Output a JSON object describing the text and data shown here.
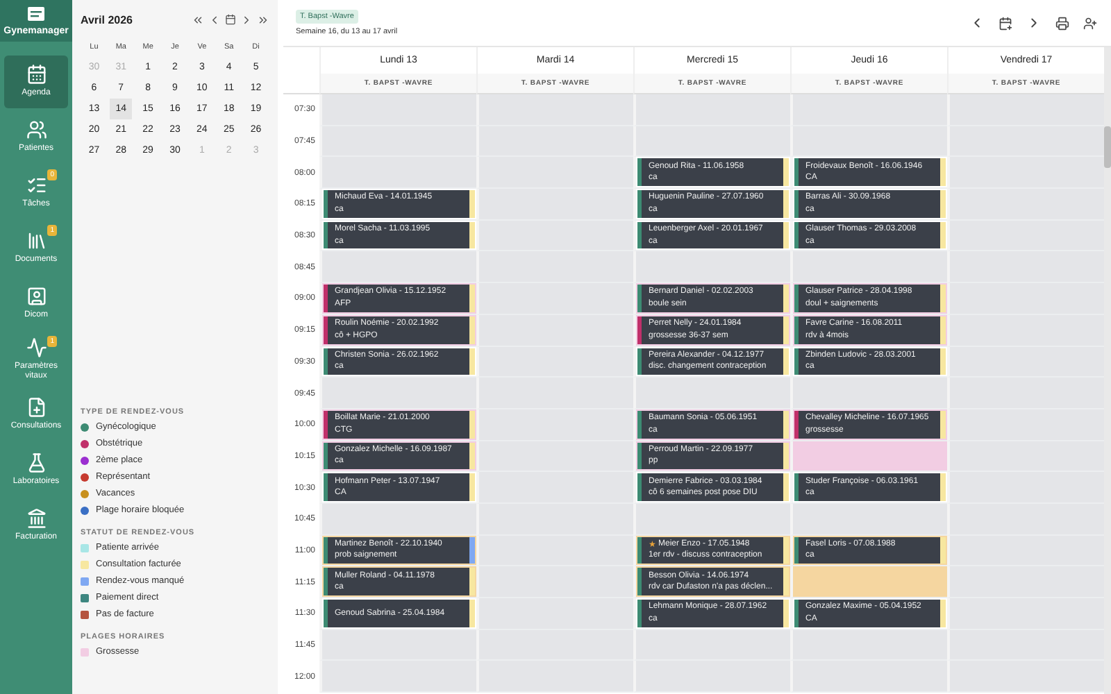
{
  "app": {
    "name": "Gynemanager"
  },
  "nav": [
    {
      "label": "Agenda",
      "selected": true
    },
    {
      "label": "Patientes",
      "selected": false
    },
    {
      "label": "Tâches",
      "selected": false,
      "badge": "0"
    },
    {
      "label": "Documents",
      "selected": false,
      "badge": "1"
    },
    {
      "label": "Dicom",
      "selected": false
    },
    {
      "label": "Paramètres vitaux",
      "selected": false,
      "badge": "1"
    },
    {
      "label": "Consultations",
      "selected": false
    },
    {
      "label": "Laboratoires",
      "selected": false
    },
    {
      "label": "Facturation",
      "selected": false
    }
  ],
  "mini_calendar": {
    "title": "Avril 2026",
    "weekdays": [
      "Lu",
      "Ma",
      "Me",
      "Je",
      "Ve",
      "Sa",
      "Di"
    ],
    "weeks": [
      [
        {
          "label": "30",
          "muted": true,
          "selected": false
        },
        {
          "label": "31",
          "muted": true,
          "selected": false
        },
        {
          "label": "1",
          "muted": false,
          "selected": false
        },
        {
          "label": "2",
          "muted": false,
          "selected": false
        },
        {
          "label": "3",
          "muted": false,
          "selected": false
        },
        {
          "label": "4",
          "muted": false,
          "selected": false
        },
        {
          "label": "5",
          "muted": false,
          "selected": false
        }
      ],
      [
        {
          "label": "6",
          "muted": false,
          "selected": false
        },
        {
          "label": "7",
          "muted": false,
          "selected": false
        },
        {
          "label": "8",
          "muted": false,
          "selected": false
        },
        {
          "label": "9",
          "muted": false,
          "selected": false
        },
        {
          "label": "10",
          "muted": false,
          "selected": false
        },
        {
          "label": "11",
          "muted": false,
          "selected": false
        },
        {
          "label": "12",
          "muted": false,
          "selected": false
        }
      ],
      [
        {
          "label": "13",
          "muted": false,
          "selected": false
        },
        {
          "label": "14",
          "muted": false,
          "selected": true
        },
        {
          "label": "15",
          "muted": false,
          "selected": false
        },
        {
          "label": "16",
          "muted": false,
          "selected": false
        },
        {
          "label": "17",
          "muted": false,
          "selected": false
        },
        {
          "label": "18",
          "muted": false,
          "selected": false
        },
        {
          "label": "19",
          "muted": false,
          "selected": false
        }
      ],
      [
        {
          "label": "20",
          "muted": false,
          "selected": false
        },
        {
          "label": "21",
          "muted": false,
          "selected": false
        },
        {
          "label": "22",
          "muted": false,
          "selected": false
        },
        {
          "label": "23",
          "muted": false,
          "selected": false
        },
        {
          "label": "24",
          "muted": false,
          "selected": false
        },
        {
          "label": "25",
          "muted": false,
          "selected": false
        },
        {
          "label": "26",
          "muted": false,
          "selected": false
        }
      ],
      [
        {
          "label": "27",
          "muted": false,
          "selected": false
        },
        {
          "label": "28",
          "muted": false,
          "selected": false
        },
        {
          "label": "29",
          "muted": false,
          "selected": false
        },
        {
          "label": "30",
          "muted": false,
          "selected": false
        },
        {
          "label": "1",
          "muted": true,
          "selected": false
        },
        {
          "label": "2",
          "muted": true,
          "selected": false
        },
        {
          "label": "3",
          "muted": true,
          "selected": false
        }
      ]
    ]
  },
  "legend": [
    {
      "title": "TYPE DE RENDEZ-VOUS",
      "kind": "dot",
      "items": [
        {
          "label": "Gynécologique",
          "color": "#3d8b73"
        },
        {
          "label": "Obstétrique",
          "color": "#c0306a"
        },
        {
          "label": "2ème place",
          "color": "#9b2fd0"
        },
        {
          "label": "Représentant",
          "color": "#c63a2f"
        },
        {
          "label": "Vacances",
          "color": "#c8901e"
        },
        {
          "label": "Plage horaire bloquée",
          "color": "#3a6fc4"
        }
      ]
    },
    {
      "title": "STATUT DE RENDEZ-VOUS",
      "kind": "square",
      "items": [
        {
          "label": "Patiente arrivée",
          "color": "#a8e6e6"
        },
        {
          "label": "Consultation facturée",
          "color": "#f7e7a0"
        },
        {
          "label": "Rendez-vous manqué",
          "color": "#7fa8f2"
        },
        {
          "label": "Paiement direct",
          "color": "#3d8680"
        },
        {
          "label": "Pas de facture",
          "color": "#b5543f"
        }
      ]
    },
    {
      "title": "PLAGES HORAIRES",
      "kind": "square",
      "items": [
        {
          "label": "Grossesse",
          "color": "#f2cde3"
        }
      ]
    }
  ],
  "header": {
    "chip": "T. Bapst -Wavre",
    "week": "Semaine 16, du 13 au 17 avril"
  },
  "days": [
    {
      "name": "Lundi 13",
      "resource": "T. BAPST -WAVRE"
    },
    {
      "name": "Mardi 14",
      "resource": "T. BAPST -WAVRE"
    },
    {
      "name": "Mercredi 15",
      "resource": "T. BAPST -WAVRE"
    },
    {
      "name": "Jeudi 16",
      "resource": "T. BAPST -WAVRE"
    },
    {
      "name": "Vendredi 17",
      "resource": "T. BAPST -WAVRE"
    }
  ],
  "rows": [
    {
      "time": "07:30",
      "cells": [
        {
          "kind": "plain"
        },
        {
          "kind": "plain"
        },
        {
          "kind": "plain"
        },
        {
          "kind": "plain"
        },
        {
          "kind": "plain"
        }
      ]
    },
    {
      "time": "07:45",
      "cells": [
        {
          "kind": "plain"
        },
        {
          "kind": "plain"
        },
        {
          "kind": "plain"
        },
        {
          "kind": "plain"
        },
        {
          "kind": "plain"
        }
      ]
    },
    {
      "time": "08:00",
      "cells": [
        {
          "kind": "plain"
        },
        {
          "kind": "plain"
        },
        {
          "kind": "plain",
          "appointment": {
            "patient": "Genoud Rita - 11.06.1958",
            "note": "ca",
            "color": "#3d8b73",
            "missed": false
          }
        },
        {
          "kind": "plain",
          "appointment": {
            "patient": "Froidevaux Benoît - 16.06.1946",
            "note": "CA",
            "color": "#3d8b73",
            "missed": false
          }
        },
        {
          "kind": "plain"
        }
      ]
    },
    {
      "time": "08:15",
      "cells": [
        {
          "kind": "plain",
          "appointment": {
            "patient": "Michaud Eva - 14.01.1945",
            "note": "ca",
            "color": "#3d8b73",
            "missed": false
          }
        },
        {
          "kind": "plain"
        },
        {
          "kind": "plain",
          "appointment": {
            "patient": "Huguenin Pauline - 27.07.1960",
            "note": "ca",
            "color": "#3d8b73",
            "missed": false
          }
        },
        {
          "kind": "plain",
          "appointment": {
            "patient": "Barras Ali - 30.09.1968",
            "note": "ca",
            "color": "#3d8b73",
            "missed": false
          }
        },
        {
          "kind": "plain"
        }
      ]
    },
    {
      "time": "08:30",
      "cells": [
        {
          "kind": "plain",
          "appointment": {
            "patient": "Morel Sacha - 11.03.1995",
            "note": "ca",
            "color": "#3d8b73",
            "missed": false
          }
        },
        {
          "kind": "plain"
        },
        {
          "kind": "plain",
          "appointment": {
            "patient": "Leuenberger Axel - 20.01.1967",
            "note": "ca",
            "color": "#3d8b73",
            "missed": false
          }
        },
        {
          "kind": "plain",
          "appointment": {
            "patient": "Glauser Thomas - 29.03.2008",
            "note": "ca",
            "color": "#3d8b73",
            "missed": false
          }
        },
        {
          "kind": "plain"
        }
      ]
    },
    {
      "time": "08:45",
      "cells": [
        {
          "kind": "plain"
        },
        {
          "kind": "plain"
        },
        {
          "kind": "plain"
        },
        {
          "kind": "plain"
        },
        {
          "kind": "plain"
        }
      ]
    },
    {
      "time": "09:00",
      "cells": [
        {
          "kind": "pink",
          "appointment": {
            "patient": "Grandjean Olivia - 15.12.1952",
            "note": "AFP",
            "color": "#c0306a",
            "missed": false
          }
        },
        {
          "kind": "plain"
        },
        {
          "kind": "pink",
          "appointment": {
            "patient": "Bernard Daniel - 02.02.2003",
            "note": "boule sein",
            "color": "#3d8b73",
            "missed": false
          }
        },
        {
          "kind": "pink",
          "appointment": {
            "patient": "Glauser Patrice - 28.04.1998",
            "note": "doul + saignements",
            "color": "#3d8b73",
            "missed": false
          }
        },
        {
          "kind": "plain"
        }
      ]
    },
    {
      "time": "09:15",
      "cells": [
        {
          "kind": "pink",
          "appointment": {
            "patient": "Roulin Noémie - 20.02.1992",
            "note": "cô + HGPO",
            "color": "#c0306a",
            "missed": false
          }
        },
        {
          "kind": "plain"
        },
        {
          "kind": "pink",
          "appointment": {
            "patient": "Perret Nelly - 24.01.1984",
            "note": "grossesse 36-37 sem",
            "color": "#c0306a",
            "missed": false
          }
        },
        {
          "kind": "pink",
          "appointment": {
            "patient": "Favre Carine - 16.08.2011",
            "note": "rdv à 4mois",
            "color": "#3d8b73",
            "missed": false
          }
        },
        {
          "kind": "plain"
        }
      ]
    },
    {
      "time": "09:30",
      "cells": [
        {
          "kind": "plain",
          "appointment": {
            "patient": "Christen Sonia - 26.02.1962",
            "note": "ca",
            "color": "#3d8b73",
            "missed": false
          }
        },
        {
          "kind": "plain"
        },
        {
          "kind": "plain",
          "appointment": {
            "patient": "Pereira Alexander - 04.12.1977",
            "note": "disc. changement contraception",
            "color": "#3d8b73",
            "missed": false
          }
        },
        {
          "kind": "plain",
          "appointment": {
            "patient": "Zbinden Ludovic - 28.03.2001",
            "note": "ca",
            "color": "#3d8b73",
            "missed": false
          }
        },
        {
          "kind": "plain"
        }
      ]
    },
    {
      "time": "09:45",
      "cells": [
        {
          "kind": "plain"
        },
        {
          "kind": "plain"
        },
        {
          "kind": "plain"
        },
        {
          "kind": "plain"
        },
        {
          "kind": "plain"
        }
      ]
    },
    {
      "time": "10:00",
      "cells": [
        {
          "kind": "pink",
          "appointment": {
            "patient": "Boillat Marie - 21.01.2000",
            "note": "CTG",
            "color": "#c0306a",
            "missed": false
          }
        },
        {
          "kind": "plain"
        },
        {
          "kind": "pink",
          "appointment": {
            "patient": "Baumann Sonia - 05.06.1951",
            "note": "ca",
            "color": "#3d8b73",
            "missed": false
          }
        },
        {
          "kind": "pink",
          "appointment": {
            "patient": "Chevalley Micheline - 16.07.1965",
            "note": "grossesse",
            "color": "#c0306a",
            "missed": false
          }
        },
        {
          "kind": "plain"
        }
      ]
    },
    {
      "time": "10:15",
      "cells": [
        {
          "kind": "pink",
          "appointment": {
            "patient": "Gonzalez Michelle - 16.09.1987",
            "note": "ca",
            "color": "#3d8b73",
            "missed": false
          }
        },
        {
          "kind": "plain"
        },
        {
          "kind": "pink",
          "appointment": {
            "patient": "Perroud Martin - 22.09.1977",
            "note": "pp",
            "color": "#3d8b73",
            "missed": false
          }
        },
        {
          "kind": "pink"
        },
        {
          "kind": "plain"
        }
      ]
    },
    {
      "time": "10:30",
      "cells": [
        {
          "kind": "plain",
          "appointment": {
            "patient": "Hofmann Peter - 13.07.1947",
            "note": "CA",
            "color": "#3d8b73",
            "missed": false
          }
        },
        {
          "kind": "plain"
        },
        {
          "kind": "plain",
          "appointment": {
            "patient": "Demierre Fabrice - 03.03.1984",
            "note": "cô 6 semaines post pose DIU",
            "color": "#3d8b73",
            "missed": false
          }
        },
        {
          "kind": "plain",
          "appointment": {
            "patient": "Studer Françoise - 06.03.1961",
            "note": "ca",
            "color": "#3d8b73",
            "missed": false
          }
        },
        {
          "kind": "plain"
        }
      ]
    },
    {
      "time": "10:45",
      "cells": [
        {
          "kind": "plain"
        },
        {
          "kind": "plain"
        },
        {
          "kind": "plain"
        },
        {
          "kind": "plain"
        },
        {
          "kind": "plain"
        }
      ]
    },
    {
      "time": "11:00",
      "cells": [
        {
          "kind": "orange",
          "appointment": {
            "patient": "Martinez Benoît - 22.10.1940",
            "note": "prob saignement",
            "color": "#3d8b73",
            "missed": true
          }
        },
        {
          "kind": "plain"
        },
        {
          "kind": "orange",
          "appointment": {
            "flag": "★",
            "patient": "Meier Enzo - 17.05.1948",
            "note": "1er rdv - discuss contraception",
            "color": "#3d8b73",
            "missed": false
          }
        },
        {
          "kind": "orange",
          "appointment": {
            "patient": "Fasel Loris - 07.08.1988",
            "note": "ca",
            "color": "#3d8b73",
            "missed": false
          }
        },
        {
          "kind": "plain"
        }
      ]
    },
    {
      "time": "11:15",
      "cells": [
        {
          "kind": "orange",
          "appointment": {
            "patient": "Muller Roland - 04.11.1978",
            "note": "ca",
            "color": "#3d8b73",
            "missed": false
          }
        },
        {
          "kind": "plain"
        },
        {
          "kind": "orange",
          "appointment": {
            "patient": "Besson Olivia - 14.06.1974",
            "note": "rdv car Dufaston n'a pas déclen...",
            "color": "#3d8b73",
            "missed": false
          }
        },
        {
          "kind": "orange"
        },
        {
          "kind": "plain"
        }
      ]
    },
    {
      "time": "11:30",
      "cells": [
        {
          "kind": "plain",
          "appointment": {
            "patient": "Genoud Sabrina - 25.04.1984",
            "color": "#3d8b73",
            "missed": false
          }
        },
        {
          "kind": "plain"
        },
        {
          "kind": "plain",
          "appointment": {
            "patient": "Lehmann Monique - 28.07.1962",
            "note": "ca",
            "color": "#3d8b73",
            "missed": false
          }
        },
        {
          "kind": "plain",
          "appointment": {
            "patient": "Gonzalez Maxime - 05.04.1952",
            "note": "CA",
            "color": "#3d8b73",
            "missed": false
          }
        },
        {
          "kind": "plain"
        }
      ]
    },
    {
      "time": "11:45",
      "cells": [
        {
          "kind": "plain"
        },
        {
          "kind": "plain"
        },
        {
          "kind": "plain"
        },
        {
          "kind": "plain"
        },
        {
          "kind": "plain"
        }
      ]
    },
    {
      "time": "12:00",
      "cells": [
        {
          "kind": "plain"
        },
        {
          "kind": "plain"
        },
        {
          "kind": "plain"
        },
        {
          "kind": "plain"
        },
        {
          "kind": "plain"
        }
      ]
    }
  ]
}
